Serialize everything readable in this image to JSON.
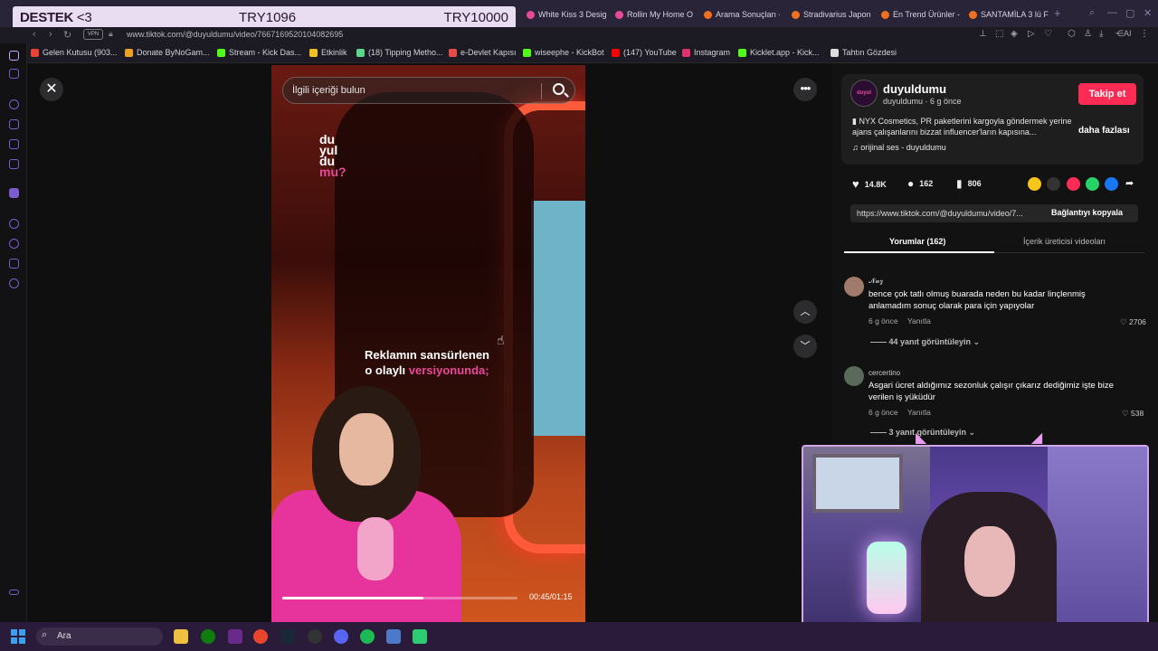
{
  "donate_banner": {
    "left": "DESTEK",
    "heart": "<3",
    "current": "TRY1096",
    "goal": "TRY10000"
  },
  "tabs": [
    {
      "label": "White Kiss 3 Desig",
      "color": "#e84a9a"
    },
    {
      "label": "Rollin My Home Ov",
      "color": "#e84a9a"
    },
    {
      "label": "Arama Sonuçları -",
      "color": "#f07020"
    },
    {
      "label": "Stradivarius Japon",
      "color": "#f07020"
    },
    {
      "label": "En Trend Ürünler -",
      "color": "#f07020"
    },
    {
      "label": "SANTAMİLA 3 lü Fu",
      "color": "#f07020"
    }
  ],
  "address": {
    "vpn": "VPN",
    "url": "www.tiktok.com/@duyuldumu/video/7667169520104082695"
  },
  "bookmarks": [
    {
      "label": "Gelen Kutusu (903...",
      "color": "#ea4335"
    },
    {
      "label": "Donate ByNoGam...",
      "color": "#f0a020"
    },
    {
      "label": "Stream - Kick Das...",
      "color": "#53fc18"
    },
    {
      "label": "Etkinlik",
      "color": "#f0c020"
    },
    {
      "label": "(18) Tipping Metho...",
      "color": "#5ad68a"
    },
    {
      "label": "e-Devlet Kapısı",
      "color": "#e84a4a"
    },
    {
      "label": "wiseephe - KickBot",
      "color": "#53fc18"
    },
    {
      "label": "(147) YouTube",
      "color": "#ff0000"
    },
    {
      "label": "Instagram",
      "color": "#e1306c"
    },
    {
      "label": "Kicklet.app - Kick...",
      "color": "#53fc18"
    },
    {
      "label": "Tahtın Gözdesi",
      "color": "#dddddd"
    }
  ],
  "video": {
    "search_placeholder": "İlgili içeriği bulun",
    "logo": [
      "du",
      "yul",
      "du",
      "mu?"
    ],
    "caption_line1": "Reklamın sansürlenen",
    "caption_line2a": "o olaylı ",
    "caption_line2b": "versiyonunda;",
    "time": "00:45/01:15",
    "progress": 0.6
  },
  "author": {
    "avatar_text": "duyul",
    "name": "duyuldumu",
    "sub": "duyuldumu · 6 g önce",
    "follow": "Takip et",
    "desc": "▮ NYX Cosmetics, PR paketlerini kargoyla göndermek yerine ajans çalışanlarını bizzat influencer'ların kapısına...",
    "more": "daha fazlası",
    "sound": "♫  orijinal ses - duyuldumu"
  },
  "stats": {
    "likes": "14.8K",
    "comments": "162",
    "saves": "806"
  },
  "link": {
    "url": "https://www.tiktok.com/@duyuldumu/video/7...",
    "copy": "Bağlantıyı kopyala"
  },
  "panel_tabs": {
    "comments": "Yorumlar (162)",
    "creator": "İçerik üreticisi videoları"
  },
  "comments": [
    {
      "name": "𝓝𝓪𝔃",
      "text": "bence çok tatlı olmuş buarada neden bu kadar linçlenmiş anlamadım sonuç olarak para için yapıyolar",
      "time": "6 g önce",
      "reply": "Yanıtla",
      "likes": "2706",
      "replies": "44 yanıt görüntüleyin"
    },
    {
      "name": "cercertino",
      "text": "Asgari ücret aldığımız sezonluk çalışır çıkarız dediğimiz işte bize verilen iş yüküdür",
      "time": "6 g önce",
      "reply": "Yanıtla",
      "likes": "538",
      "replies": "3 yanıt görüntüleyin"
    }
  ],
  "taskbar": {
    "search": "Ara"
  }
}
